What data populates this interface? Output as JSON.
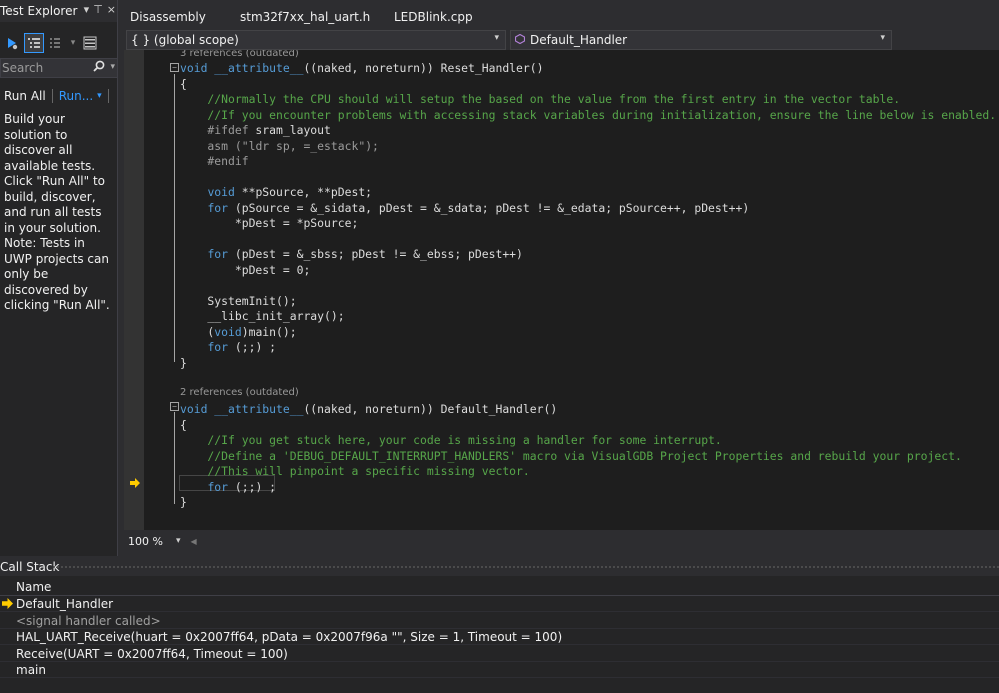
{
  "test_explorer": {
    "title": "Test Explorer",
    "pin_glyph": "⊤",
    "pin_label": "pin-icon",
    "close_glyph": "×",
    "dropdown_glyph": "▾",
    "search_placeholder": "Search",
    "run_all": "Run All",
    "run_menu": "Run...",
    "message": "Build your solution to discover all available tests. Click \"Run All\" to build, discover, and run all tests in your solution.",
    "note": "Note: Tests in UWP projects can only be discovered by clicking \"Run All\"."
  },
  "editor": {
    "tabs": [
      {
        "label": "Disassembly"
      },
      {
        "label": "stm32f7xx_hal_uart.h"
      },
      {
        "label": "LEDBlink.cpp"
      }
    ],
    "scope_combo": "{ } (global scope)",
    "member_combo": "Default_Handler",
    "codelens": [
      "3 references (outdated)",
      "2 references (outdated)"
    ],
    "zoom": "100 %",
    "accent_color": "#3399ff",
    "comment_color": "#57a64a",
    "keyword_color": "#569cd6",
    "string_color": "#d69d85"
  },
  "code": {
    "l0": [
      {
        "t": "void",
        "c": "kw"
      },
      {
        "t": " "
      },
      {
        "t": "__attribute__",
        "c": "kw"
      },
      {
        "t": "((naked, noreturn)) Reset_Handler()"
      }
    ],
    "l1": [
      {
        "t": "{"
      }
    ],
    "l2": [
      {
        "t": "    //Normally the CPU should will setup the based on the value from the first entry in the vector table.",
        "c": "cm"
      }
    ],
    "l3": [
      {
        "t": "    //If you encounter problems with accessing stack variables during initialization, ensure the line below is enabled.",
        "c": "cm"
      }
    ],
    "l4": [
      {
        "t": "    #ifdef",
        "c": "pp"
      },
      {
        "t": " sram_layout"
      }
    ],
    "l5": [
      {
        "t": "    asm (",
        "c": "pp"
      },
      {
        "t": "\"ldr sp, =_estack\"",
        "c": "pp"
      },
      {
        "t": ");",
        "c": "pp"
      }
    ],
    "l6": [
      {
        "t": "    #endif",
        "c": "pp"
      }
    ],
    "l7": [
      {
        "t": ""
      }
    ],
    "l8": [
      {
        "t": "    "
      },
      {
        "t": "void",
        "c": "kw"
      },
      {
        "t": " **pSource, **pDest;"
      }
    ],
    "l9": [
      {
        "t": "    "
      },
      {
        "t": "for",
        "c": "kw"
      },
      {
        "t": " (pSource = &_sidata, pDest = &_sdata; pDest != &_edata; pSource++, pDest++)"
      }
    ],
    "l10": [
      {
        "t": "        *pDest = *pSource;"
      }
    ],
    "l11": [
      {
        "t": ""
      }
    ],
    "l12": [
      {
        "t": "    "
      },
      {
        "t": "for",
        "c": "kw"
      },
      {
        "t": " (pDest = &_sbss; pDest != &_ebss; pDest++)"
      }
    ],
    "l13": [
      {
        "t": "        *pDest = 0;"
      }
    ],
    "l14": [
      {
        "t": ""
      }
    ],
    "l15": [
      {
        "t": "    SystemInit();"
      }
    ],
    "l16": [
      {
        "t": "    __libc_init_array();"
      }
    ],
    "l17": [
      {
        "t": "    ("
      },
      {
        "t": "void",
        "c": "kw"
      },
      {
        "t": ")main();"
      }
    ],
    "l18": [
      {
        "t": "    "
      },
      {
        "t": "for",
        "c": "kw"
      },
      {
        "t": " (;;) ;"
      }
    ],
    "l19": [
      {
        "t": "}"
      }
    ],
    "l20": [
      {
        "t": "void",
        "c": "kw"
      },
      {
        "t": " "
      },
      {
        "t": "__attribute__",
        "c": "kw"
      },
      {
        "t": "((naked, noreturn)) Default_Handler()"
      }
    ],
    "l21": [
      {
        "t": "{"
      }
    ],
    "l22": [
      {
        "t": "    //If you get stuck here, your code is missing a handler for some interrupt.",
        "c": "cm"
      }
    ],
    "l23": [
      {
        "t": "    //Define a '",
        "c": "cm"
      },
      {
        "t": "DEBUG_DEFAULT_INTERRUPT_HANDLERS",
        "c": "cm"
      },
      {
        "t": "' macro via VisualGDB Project Properties and rebuild your project.",
        "c": "cm"
      }
    ],
    "l24": [
      {
        "t": "    //This will pinpoint a specific missing vector.",
        "c": "cm"
      }
    ],
    "l25": [
      {
        "t": "    "
      },
      {
        "t": "for",
        "c": "kw"
      },
      {
        "t": " (;;) ;"
      }
    ],
    "l26": [
      {
        "t": "}"
      }
    ]
  },
  "callstack": {
    "title": "Call Stack",
    "column_name": "Name",
    "frames": [
      "Default_Handler",
      "<signal handler called>",
      "HAL_UART_Receive(huart = 0x2007ff64, pData = 0x2007f96a \"\", Size = 1, Timeout = 100)",
      "Receive(UART = 0x2007ff64, Timeout = 100)",
      "main"
    ]
  }
}
